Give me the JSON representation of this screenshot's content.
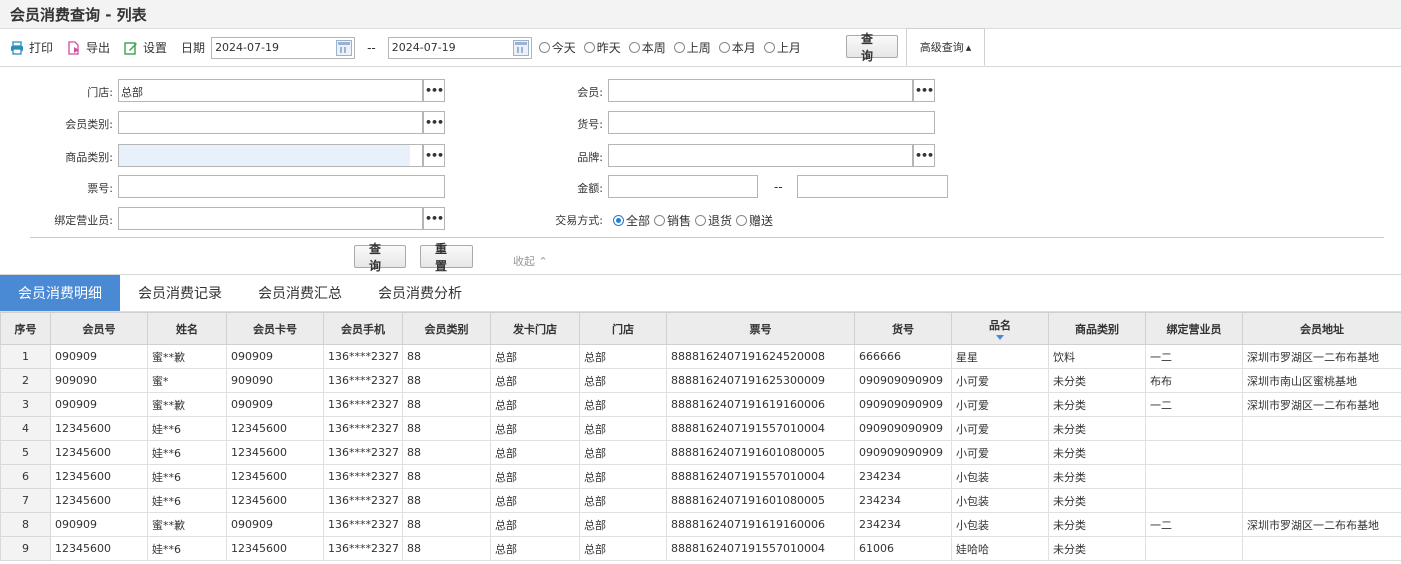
{
  "page": {
    "title": "会员消费查询 - 列表"
  },
  "toolbar": {
    "print_label": "打印",
    "export_label": "导出",
    "settings_label": "设置",
    "date_label": "日期",
    "date_from": "2024-07-19",
    "date_sep": "--",
    "date_to": "2024-07-19",
    "quick_ranges": [
      "今天",
      "昨天",
      "本周",
      "上周",
      "本月",
      "上月"
    ],
    "query_label": "查询",
    "advanced_label": "高级查询",
    "advanced_arrow": "▴"
  },
  "form": {
    "store_label": "门店:",
    "store_value": "总部",
    "member_type_label": "会员类别:",
    "goods_type_label": "商品类别:",
    "ticket_label": "票号:",
    "salesman_label": "绑定营业员:",
    "member_label": "会员:",
    "sku_label": "货号:",
    "brand_label": "品牌:",
    "amount_label": "金额:",
    "amount_sep": "--",
    "trade_label": "交易方式:",
    "trade_options": [
      "全部",
      "销售",
      "退货",
      "赠送"
    ],
    "more_glyph": "•••",
    "query_label": "查询",
    "reset_label": "重置",
    "collapse_label": "收起"
  },
  "tabs": [
    "会员消费明细",
    "会员消费记录",
    "会员消费汇总",
    "会员消费分析"
  ],
  "table": {
    "headers": [
      "序号",
      "会员号",
      "姓名",
      "会员卡号",
      "会员手机",
      "会员类别",
      "发卡门店",
      "门店",
      "票号",
      "货号",
      "品名",
      "商品类别",
      "绑定营业员",
      "会员地址"
    ],
    "rows": [
      [
        "1",
        "090909",
        "蜜**歉",
        "090909",
        "136****2327",
        "88",
        "总部",
        "总部",
        "888816240719162452000​8",
        "666666",
        "星星",
        "饮料",
        "一二",
        "深圳市罗湖区一二布布基地"
      ],
      [
        "2",
        "909090",
        "蜜*",
        "909090",
        "136****2327",
        "88",
        "总部",
        "总部",
        "8888162407191625300009",
        "090909090909",
        "小可爱",
        "未分类",
        "布布",
        "深圳市南山区蜜桃基地"
      ],
      [
        "3",
        "090909",
        "蜜**歉",
        "090909",
        "136****2327",
        "88",
        "总部",
        "总部",
        "8888162407191619160006",
        "090909090909",
        "小可爱",
        "未分类",
        "一二",
        "深圳市罗湖区一二布布基地"
      ],
      [
        "4",
        "12345600",
        "娃**6",
        "12345600",
        "136****2327",
        "88",
        "总部",
        "总部",
        "8888162407191557010004",
        "090909090909",
        "小可爱",
        "未分类",
        "",
        ""
      ],
      [
        "5",
        "12345600",
        "娃**6",
        "12345600",
        "136****2327",
        "88",
        "总部",
        "总部",
        "8888162407191601080005",
        "090909090909",
        "小可爱",
        "未分类",
        "",
        ""
      ],
      [
        "6",
        "12345600",
        "娃**6",
        "12345600",
        "136****2327",
        "88",
        "总部",
        "总部",
        "8888162407191557010004",
        "234234",
        "小包装",
        "未分类",
        "",
        ""
      ],
      [
        "7",
        "12345600",
        "娃**6",
        "12345600",
        "136****2327",
        "88",
        "总部",
        "总部",
        "8888162407191601080005",
        "234234",
        "小包装",
        "未分类",
        "",
        ""
      ],
      [
        "8",
        "090909",
        "蜜**歉",
        "090909",
        "136****2327",
        "88",
        "总部",
        "总部",
        "8888162407191619160006",
        "234234",
        "小包装",
        "未分类",
        "一二",
        "深圳市罗湖区一二布布基地"
      ],
      [
        "9",
        "12345600",
        "娃**6",
        "12345600",
        "136****2327",
        "88",
        "总部",
        "总部",
        "8888162407191557010004",
        "61006",
        "娃哈哈",
        "未分类",
        "",
        ""
      ]
    ]
  },
  "colors": {
    "accent": "#4a8ad4",
    "header_bg": "#ececec",
    "print_icon": "#2a8fbd",
    "export_icon": "#d14fa0",
    "settings_icon": "#3aa34a"
  }
}
